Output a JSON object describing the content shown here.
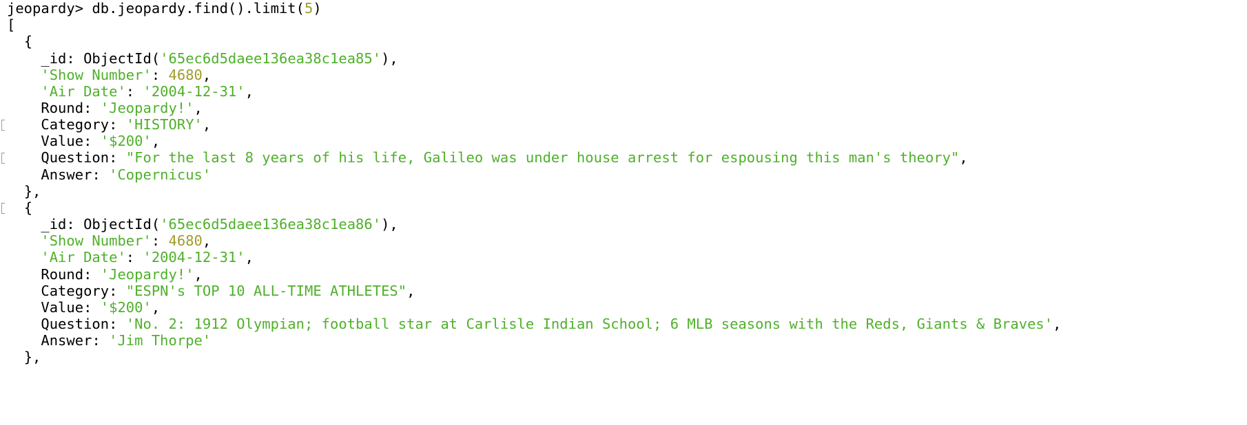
{
  "colors": {
    "string": "#4fb02a",
    "number": "#a09c2a",
    "plain": "#000000"
  },
  "prompt": {
    "label": "jeopardy>",
    "cmd_before": "db.jeopardy.find().limit(",
    "cmd_arg": "5",
    "cmd_after": ")"
  },
  "brackets": {
    "array_open": "[",
    "doc_open": "{",
    "doc_close": "},"
  },
  "documents": [
    {
      "id_key": "_id",
      "id_func": "ObjectId(",
      "id_value": "'65ec6d5daee136ea38c1ea85'",
      "id_suffix": "),",
      "show_number_key": "'Show Number'",
      "show_number_value": "4680",
      "air_date_key": "'Air Date'",
      "air_date_value": "'2004-12-31'",
      "round_key": "Round",
      "round_value": "'Jeopardy!'",
      "category_key": "Category",
      "category_value": "'HISTORY'",
      "value_key": "Value",
      "value_value": "'$200'",
      "question_key": "Question",
      "question_value": "\"For the last 8 years of his life, Galileo was under house arrest for espousing this man's theory\"",
      "answer_key": "Answer",
      "answer_value": "'Copernicus'"
    },
    {
      "id_key": "_id",
      "id_func": "ObjectId(",
      "id_value": "'65ec6d5daee136ea38c1ea86'",
      "id_suffix": "),",
      "show_number_key": "'Show Number'",
      "show_number_value": "4680",
      "air_date_key": "'Air Date'",
      "air_date_value": "'2004-12-31'",
      "round_key": "Round",
      "round_value": "'Jeopardy!'",
      "category_key": "Category",
      "category_value": "\"ESPN's TOP 10 ALL-TIME ATHLETES\"",
      "value_key": "Value",
      "value_value": "'$200'",
      "question_key": "Question",
      "question_value": "'No. 2: 1912 Olympian; football star at Carlisle Indian School; 6 MLB seasons with the Reds, Giants & Braves'",
      "answer_key": "Answer",
      "answer_value": "'Jim Thorpe'"
    }
  ]
}
